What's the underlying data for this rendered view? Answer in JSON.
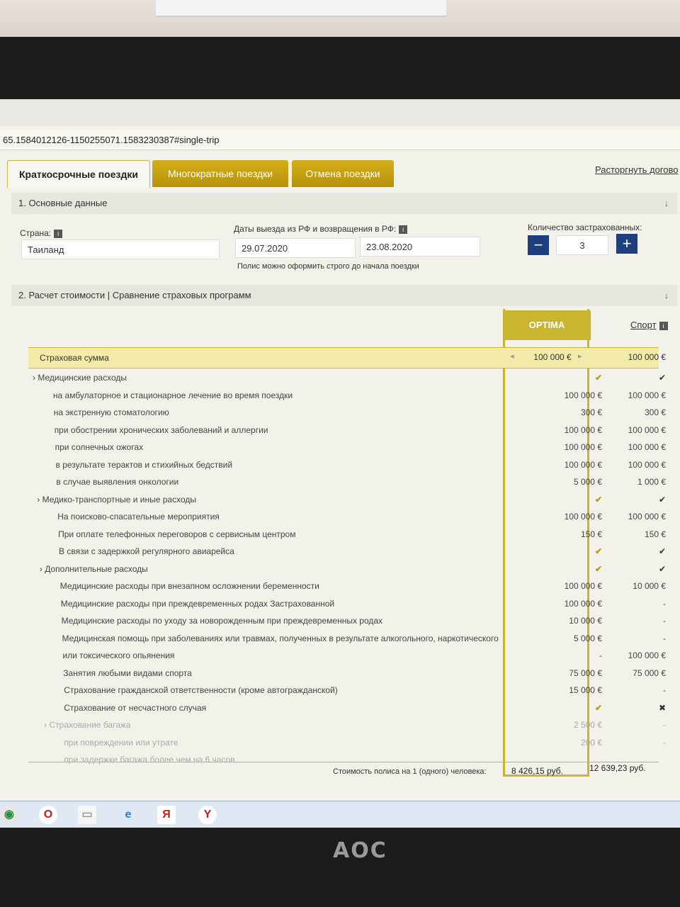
{
  "url": "65.1584012126-1150255071.1583230387#single-trip",
  "tabs": [
    "Краткосрочные поездки",
    "Многократные поездки",
    "Отмена поездки"
  ],
  "right_link": "Расторгнуть догово",
  "section1": "1. Основные данные",
  "country_label": "Страна:",
  "country_value": "Таиланд",
  "dates_label": "Даты выезда из РФ и возвращения в РФ:",
  "date_from": "29.07.2020",
  "date_to": "23.08.2020",
  "dates_note": "Полис можно оформить строго до начала поездки",
  "insured_label": "Количество застрахованных:",
  "insured_count": "3",
  "section2": "2. Расчет стоимости | Сравнение страховых программ",
  "plan1": "OPTIMA",
  "plan2": "Спорт",
  "sum_label": "Страховая сумма",
  "sum_plan1": "100 000 €",
  "sum_plan2": "100 000 €",
  "rows": [
    {
      "t": "Медицинские расходы",
      "a": "✔",
      "b": "✔",
      "type": "group"
    },
    {
      "t": "на амбулаторное и стационарное лечение во время поездки",
      "a": "100 000 €",
      "b": "100 000 €"
    },
    {
      "t": "на экстренную стоматологию",
      "a": "300 €",
      "b": "300 €"
    },
    {
      "t": "при обострении хронических заболеваний и аллергии",
      "a": "100 000 €",
      "b": "100 000 €"
    },
    {
      "t": "при солнечных ожогах",
      "a": "100 000 €",
      "b": "100 000 €"
    },
    {
      "t": "в результате терактов и стихийных бедствий",
      "a": "100 000 €",
      "b": "100 000 €"
    },
    {
      "t": "в случае выявления онкологии",
      "a": "5 000 €",
      "b": "1 000 €"
    },
    {
      "t": "Медико-транспортные и иные расходы",
      "a": "✔",
      "b": "✔",
      "type": "group"
    },
    {
      "t": "На поисково-спасательные мероприятия",
      "a": "100 000 €",
      "b": "100 000 €"
    },
    {
      "t": "При оплате телефонных переговоров с сервисным центром",
      "a": "150 €",
      "b": "150 €"
    },
    {
      "t": "В связи с задержкой регулярного авиарейса",
      "a": "✔",
      "b": "✔"
    },
    {
      "t": "Дополнительные расходы",
      "a": "✔",
      "b": "✔",
      "type": "group"
    },
    {
      "t": "Медицинские расходы при внезапном осложнении беременности",
      "a": "100 000 €",
      "b": "10 000 €"
    },
    {
      "t": "Медицинские расходы при преждевременных родах Застрахованной",
      "a": "100 000 €",
      "b": "-"
    },
    {
      "t": "Медицинские расходы по уходу за новорожденным при преждевременных родах",
      "a": "10 000 €",
      "b": "-"
    },
    {
      "t": "Медицинская помощь при заболеваниях или травмах, полученных в результате алкогольного, наркотического",
      "a": "5 000 €",
      "b": "-"
    },
    {
      "t": "или токсического опьянения",
      "a": "-",
      "b": "100 000 €"
    },
    {
      "t": "Занятия любыми видами спорта",
      "a": "75 000 €",
      "b": "75 000 €"
    },
    {
      "t": "Страхование гражданской ответственности (кроме автогражданской)",
      "a": "15 000 €",
      "b": "-"
    },
    {
      "t": "Страхование от несчастного случая",
      "a": "✔",
      "b": "✖"
    },
    {
      "t": "Страхование багажа",
      "a": "2 500 €",
      "b": "-",
      "type": "group",
      "muted": true
    },
    {
      "t": "при повреждении или утрате",
      "a": "200 €",
      "b": "-",
      "muted": true
    },
    {
      "t": "при задержке багажа более чем на 6 часов",
      "a": "",
      "b": "",
      "muted": true
    }
  ],
  "total_label": "Стоимость полиса на 1 (одного) человека:",
  "total_plan1": "8 426,15 руб.",
  "total_plan2": "12 639,23 руб.",
  "monitor_brand": "AOC",
  "icons": [
    "chrome-icon",
    "opera-icon",
    "file-icon",
    "ie-icon",
    "yandex-icon",
    "yandex-browser-icon"
  ]
}
